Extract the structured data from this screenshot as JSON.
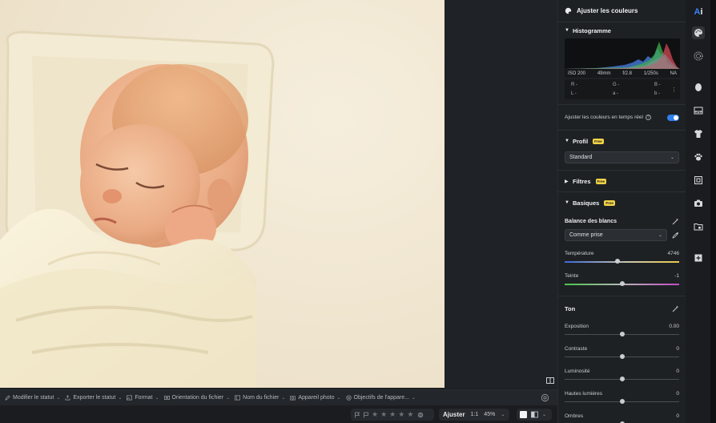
{
  "panel": {
    "title": "Ajuster les couleurs",
    "histogram": {
      "title": "Histogramme",
      "iso": "ISO 200",
      "focal": "49mm",
      "aperture": "f/2.8",
      "shutter": "1/250s",
      "format": "NA",
      "r_label": "R -",
      "g_label": "G -",
      "b_label": "B -",
      "l_label": "L -",
      "a_label": "a -",
      "bb_label": "b -"
    },
    "realtime_label": "Ajuster les couleurs en temps réel",
    "profil": {
      "title": "Profil",
      "badge": "Free",
      "value": "Standard"
    },
    "filtres": {
      "title": "Filtres",
      "badge": "Free"
    },
    "basiques": {
      "title": "Basiques",
      "badge": "Free",
      "wb_label": "Balance des blancs",
      "wb_value": "Comme prise",
      "temperature": {
        "label": "Température",
        "value": "4746",
        "position": 0.46
      },
      "teinte": {
        "label": "Teinte",
        "value": "-1",
        "position": 0.5
      }
    },
    "ton": {
      "title": "Ton",
      "sliders": [
        {
          "label": "Exposition",
          "value": "0.00",
          "position": 0.5
        },
        {
          "label": "Contraste",
          "value": "0",
          "position": 0.5
        },
        {
          "label": "Luminosité",
          "value": "0",
          "position": 0.5
        },
        {
          "label": "Hautes lumières",
          "value": "0",
          "position": 0.5
        },
        {
          "label": "Ombres",
          "value": "0",
          "position": 0.5
        }
      ]
    },
    "toggle_on": true
  },
  "meta_bar": {
    "items": [
      "Modifier le statut",
      "Exporter le statut",
      "Format",
      "Orientation du fichier",
      "Nom du fichier",
      "Appareil photo",
      "Objectifs de l'appare..."
    ]
  },
  "status_bar": {
    "star_count": 5,
    "mode": "Ajuster",
    "ratio": "1:1",
    "zoom": "45%"
  },
  "rail": {
    "logo_a": "A",
    "logo_i": "i"
  },
  "colors": {
    "accent": "#2f80ed",
    "badge": "#f2d447",
    "panel_bg": "#1e2124"
  }
}
